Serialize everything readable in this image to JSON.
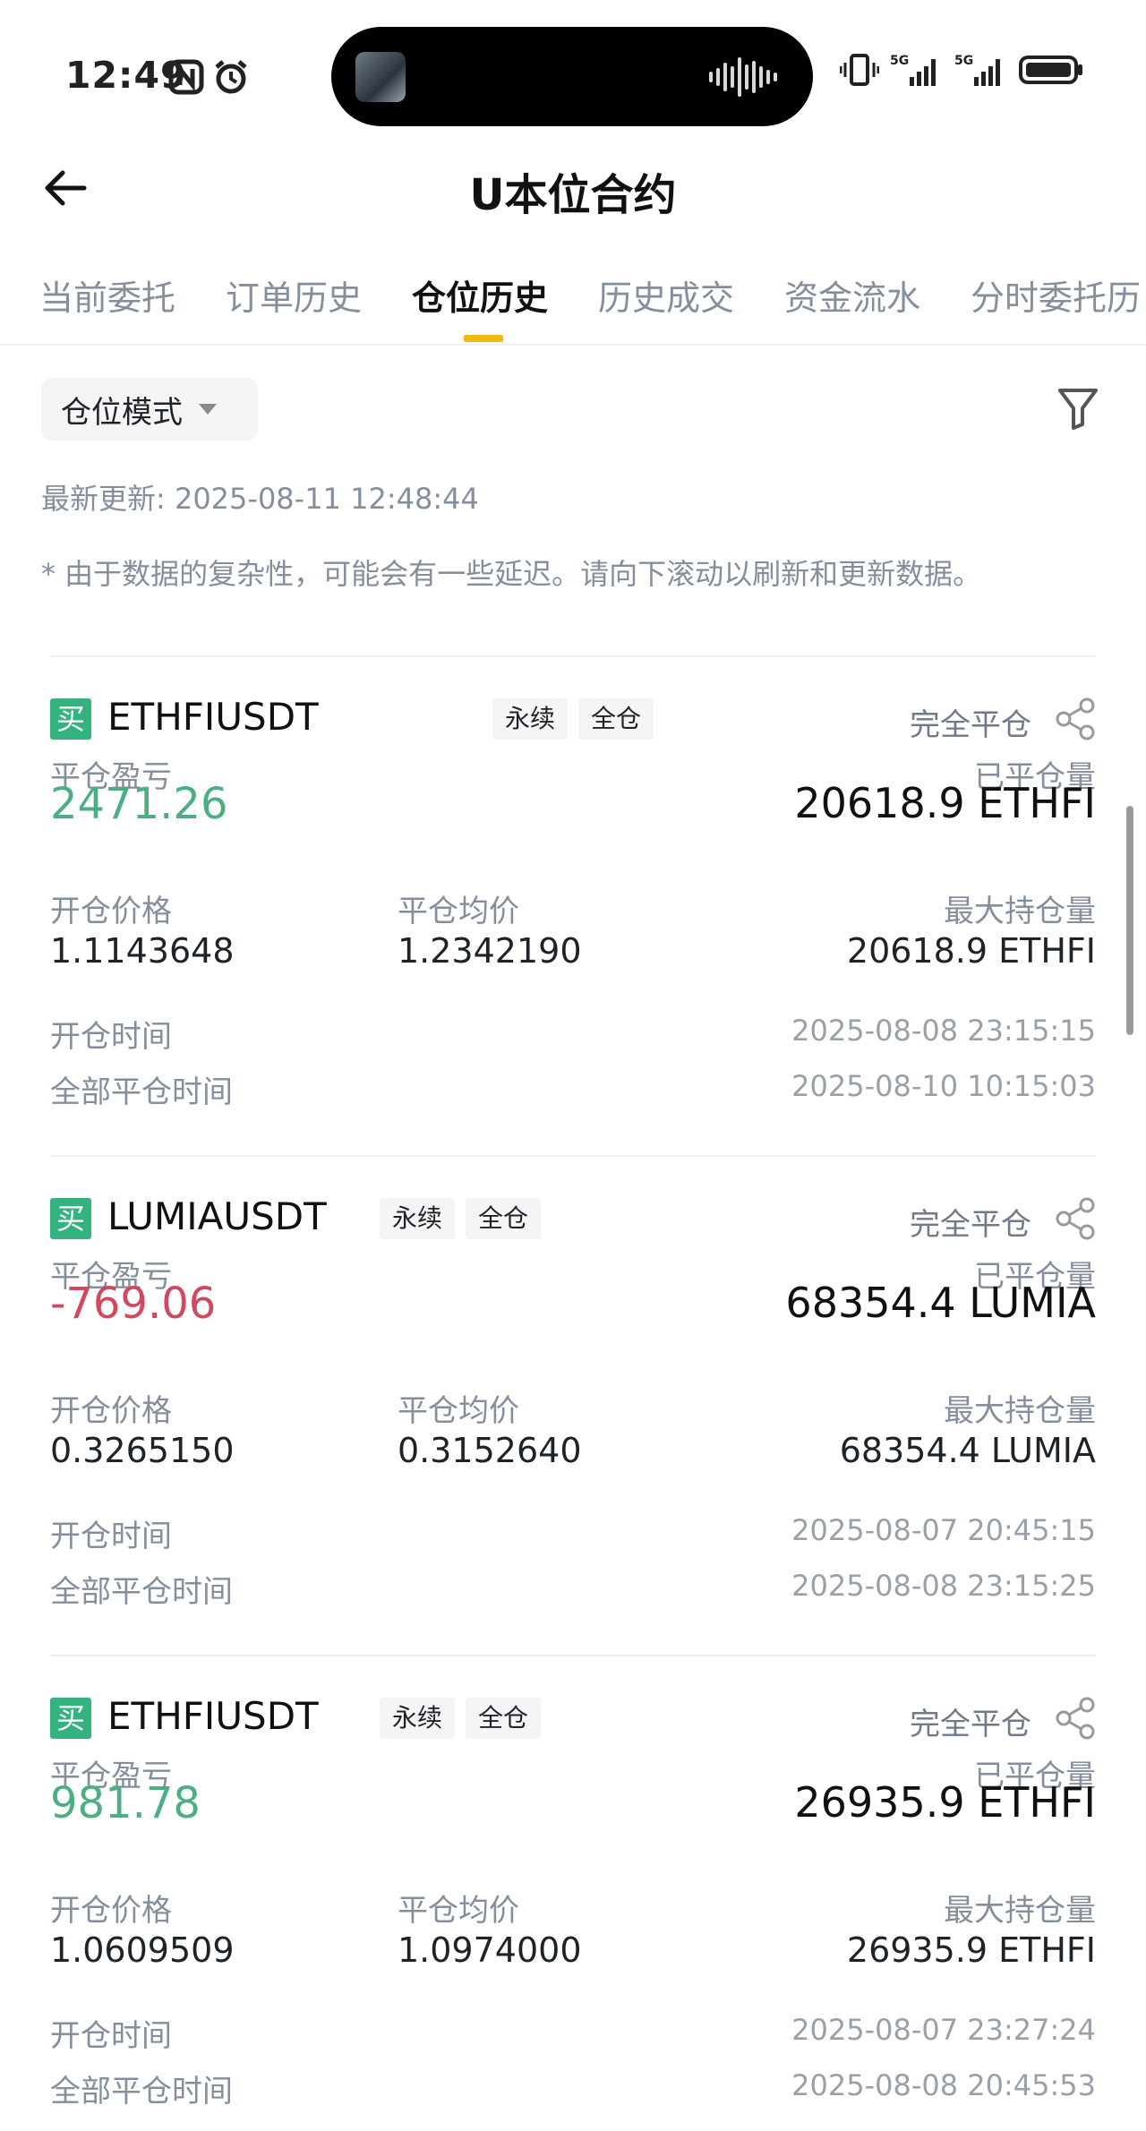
{
  "status_bar": {
    "time": "12:49"
  },
  "header": {
    "title": "U本位合约"
  },
  "tabs": [
    {
      "label": "当前委托"
    },
    {
      "label": "订单历史"
    },
    {
      "label": "仓位历史"
    },
    {
      "label": "历史成交"
    },
    {
      "label": "资金流水"
    },
    {
      "label": "分时委托历"
    }
  ],
  "active_tab_index": 2,
  "filter": {
    "mode_label": "仓位模式"
  },
  "last_updated": "最新更新: 2025-08-11 12:48:44",
  "disclaimer": "* 由于数据的复杂性，可能会有一些延迟。请向下滚动以刷新和更新数据。",
  "labels": {
    "pnl": "平仓盈亏",
    "closed_qty": "已平仓量",
    "open_price": "开仓价格",
    "close_avg": "平仓均价",
    "max_qty": "最大持仓量",
    "open_time": "开仓时间",
    "close_time": "全部平仓时间"
  },
  "positions": [
    {
      "side": "买",
      "symbol": "ETHFIUSDT",
      "tag_type": "永续",
      "tag_margin": "全仓",
      "status": "完全平仓",
      "pnl": "2471.26",
      "pnl_dir": "up",
      "closed_qty": "20618.9 ETHFI",
      "open_price": "1.1143648",
      "close_avg": "1.2342190",
      "max_qty": "20618.9 ETHFI",
      "open_time": "2025-08-08 23:15:15",
      "close_time": "2025-08-10 10:15:03"
    },
    {
      "side": "买",
      "symbol": "LUMIAUSDT",
      "tag_type": "永续",
      "tag_margin": "全仓",
      "status": "完全平仓",
      "pnl": "-769.06",
      "pnl_dir": "down",
      "closed_qty": "68354.4 LUMIA",
      "open_price": "0.3265150",
      "close_avg": "0.3152640",
      "max_qty": "68354.4 LUMIA",
      "open_time": "2025-08-07 20:45:15",
      "close_time": "2025-08-08 23:15:25"
    },
    {
      "side": "买",
      "symbol": "ETHFIUSDT",
      "tag_type": "永续",
      "tag_margin": "全仓",
      "status": "完全平仓",
      "pnl": "981.78",
      "pnl_dir": "up",
      "closed_qty": "26935.9 ETHFI",
      "open_price": "1.0609509",
      "close_avg": "1.0974000",
      "max_qty": "26935.9 ETHFI",
      "open_time": "2025-08-07 23:27:24",
      "close_time": "2025-08-08 20:45:53"
    }
  ],
  "colors": {
    "up": "#4caf83",
    "down": "#d0495f",
    "accent": "#f0b90b",
    "buy_badge": "#35b37e"
  }
}
